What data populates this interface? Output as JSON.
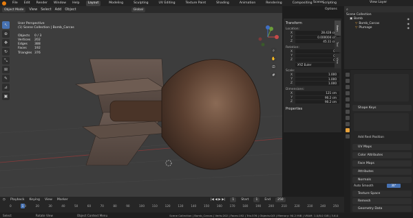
{
  "topbar": {
    "menus": [
      "File",
      "Edit",
      "Render",
      "Window",
      "Help"
    ],
    "tabs": [
      "Layout",
      "Modeling",
      "Sculpting",
      "UV Editing",
      "Texture Paint",
      "Shading",
      "Animation",
      "Rendering",
      "Compositing",
      "Scripting"
    ],
    "scene": "Scene",
    "view_layer": "View Layer"
  },
  "viewport_header": {
    "mode": "Object Mode",
    "menus": [
      "View",
      "Select",
      "Add",
      "Object"
    ],
    "transform": "Global",
    "options": "Options"
  },
  "info": {
    "view": "User Perspective",
    "collection": "(1) Scene Collection | Bomb_Carcas",
    "stats": [
      {
        "k": "Objects",
        "v": "0 / 3"
      },
      {
        "k": "Vertices",
        "v": "202"
      },
      {
        "k": "Edges",
        "v": "388"
      },
      {
        "k": "Faces",
        "v": "192"
      },
      {
        "k": "Triangles",
        "v": "376"
      }
    ]
  },
  "npanel": {
    "title": "Transform",
    "location_label": "Location:",
    "location": [
      {
        "a": "X",
        "v": "28.428 cm"
      },
      {
        "a": "Y",
        "v": "0.000004 cm"
      },
      {
        "a": "Z",
        "v": "45.11 cm"
      }
    ],
    "rotation_label": "Rotation:",
    "rotation": [
      {
        "a": "X",
        "v": "0°"
      },
      {
        "a": "Y",
        "v": "0°"
      },
      {
        "a": "Z",
        "v": "0°"
      }
    ],
    "rotation_mode": "XYZ Euler",
    "scale_label": "Scale:",
    "scale": [
      {
        "a": "X",
        "v": "1.000"
      },
      {
        "a": "Y",
        "v": "1.000"
      },
      {
        "a": "Z",
        "v": "1.000"
      }
    ],
    "dimensions_label": "Dimensions:",
    "dimensions": [
      {
        "a": "X",
        "v": "121 cm"
      },
      {
        "a": "Y",
        "v": "90.2 cm"
      },
      {
        "a": "Z",
        "v": "90.2 cm"
      }
    ],
    "properties": "Properties",
    "tabs": [
      "Item",
      "Tool",
      "View"
    ]
  },
  "outliner": {
    "collection": "Scene Collection",
    "items": [
      {
        "label": "Bomb",
        "indent": 1
      },
      {
        "label": "Bomb_Carcas",
        "indent": 2
      },
      {
        "label": "Plumage",
        "indent": 2
      }
    ]
  },
  "properties": {
    "sections": [
      "Shape Keys",
      "UV Maps",
      "Color Attributes",
      "Face Maps",
      "Attributes",
      "Normals",
      "Texture Space",
      "Remesh",
      "Geometry Data"
    ],
    "add_rest": "Add Rest Position",
    "auto_smooth": "Auto Smooth",
    "auto_smooth_value": "30°"
  },
  "timeline": {
    "menus": [
      "Playback",
      "Keying",
      "View",
      "Marker"
    ],
    "current_frame": "1",
    "start_label": "Start",
    "start": "1",
    "end_label": "End",
    "end": "250",
    "ticks": [
      "0",
      "10",
      "20",
      "30",
      "40",
      "50",
      "60",
      "70",
      "80",
      "90",
      "100",
      "110",
      "120",
      "130",
      "140",
      "150",
      "160",
      "170",
      "180",
      "190",
      "200",
      "210",
      "220",
      "230",
      "240",
      "250"
    ]
  },
  "statusbar": {
    "select": "Select",
    "rotate": "Rotate View",
    "context": "Object Context Menu",
    "stats": "Scene Collection | Bomb_Carcas | Verts:202 | Faces:192 | Tris:376 | Objects:0/3 | Memory: 90.2 MiB | VRAM: 1.0/8.0 GiB | 3.6.0"
  },
  "colors": {
    "accent": "#4772b3",
    "orange": "#e87d0d"
  }
}
